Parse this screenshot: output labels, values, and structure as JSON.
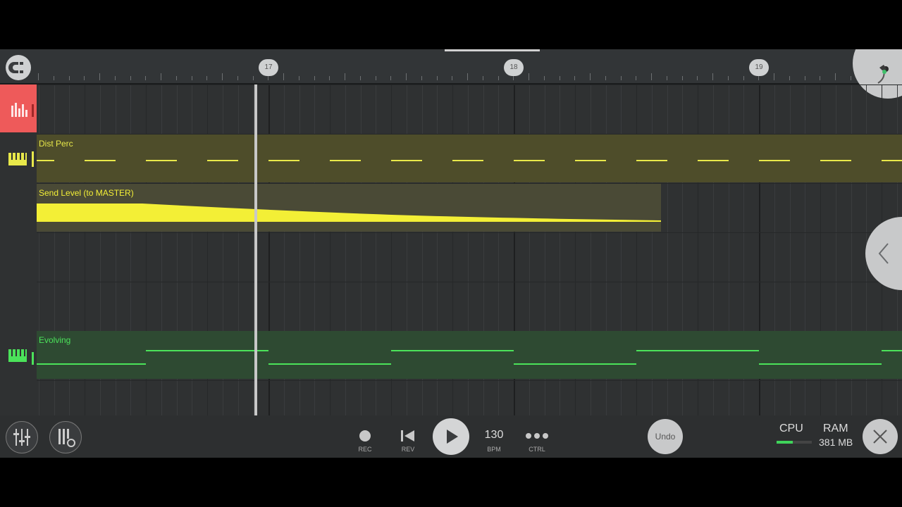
{
  "ruler": {
    "bars": [
      "17",
      "18",
      "19"
    ]
  },
  "tracks": [
    {
      "name": "",
      "type": "audio",
      "color": "#ee5a5a"
    },
    {
      "name": "Dist Perc",
      "type": "pattern",
      "color": "#e8e84a",
      "clip_bg": "#4e4d2a"
    },
    {
      "name": "Send Level (to MASTER)",
      "type": "automation",
      "color": "#f3ef36",
      "clip_bg": "#4a4a36"
    },
    {
      "name": "Evolving",
      "type": "pattern",
      "color": "#4be35a",
      "clip_bg": "#2e4a32"
    }
  ],
  "transport": {
    "rec_label": "REC",
    "rev_label": "REV",
    "bpm_value": "130",
    "bpm_label": "BPM",
    "ctrl_label": "CTRL",
    "undo_label": "Undo",
    "cpu_label": "CPU",
    "ram_label": "RAM",
    "ram_value": "381 MB",
    "cpu_level": 0.45
  },
  "icons": {
    "magnet": "magnet-icon",
    "mixer": "mixer-icon",
    "channel-settings": "channel-settings-icon",
    "play": "play-icon",
    "close": "close-icon",
    "collapse": "chevron-left-icon",
    "app-logo": "fl-fruit-logo-icon"
  }
}
